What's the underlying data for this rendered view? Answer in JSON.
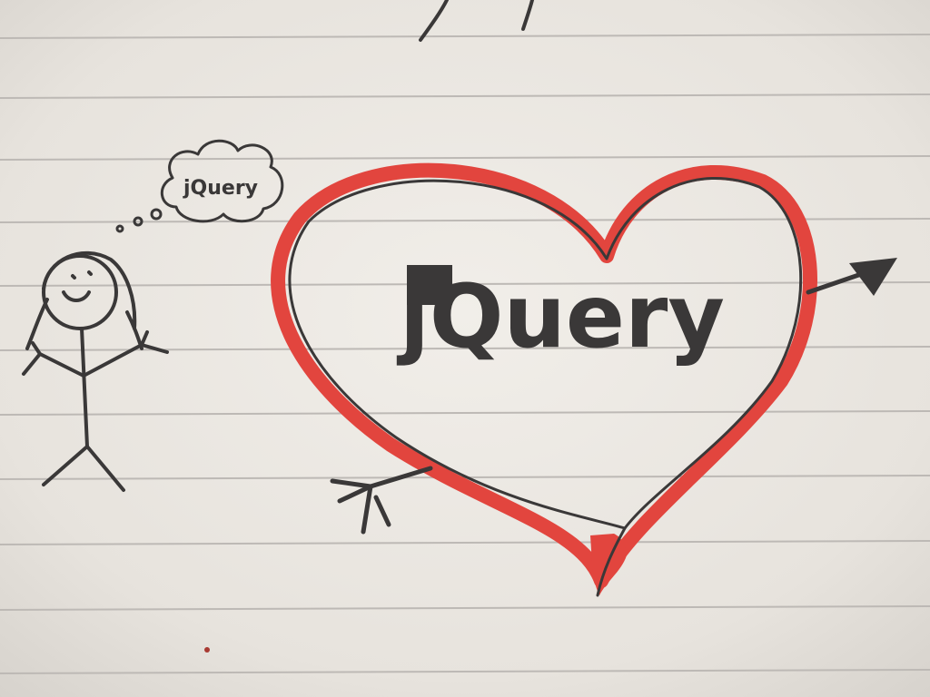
{
  "heart_text": "jQuery",
  "thought_text": "jQuery",
  "colors": {
    "paper": "#e9e6e0",
    "rule_line": "#bdb9b5",
    "ink": "#3a3838",
    "heart_red": "#e2453e"
  }
}
